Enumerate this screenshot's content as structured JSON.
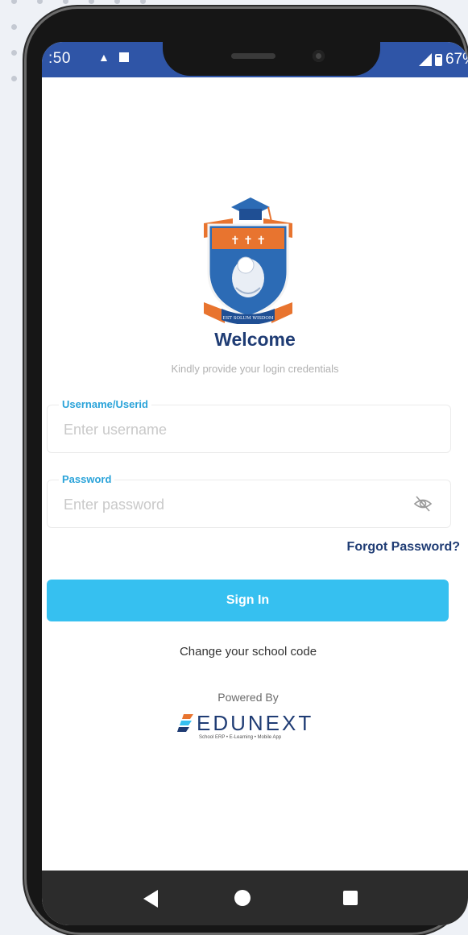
{
  "status_bar": {
    "time": ":50",
    "battery": "67%"
  },
  "logo": {
    "school_motto": "EST SOLUM WISDOM"
  },
  "login": {
    "welcome": "Welcome",
    "subtitle": "Kindly provide your login credentials",
    "username_label": "Username/Userid",
    "username_placeholder": "Enter username",
    "username_value": "",
    "password_label": "Password",
    "password_placeholder": "Enter password",
    "password_value": "",
    "forgot_password": "Forgot Password?",
    "sign_in": "Sign In",
    "change_school_code": "Change your school code"
  },
  "footer": {
    "powered_by": "Powered By",
    "brand_name": "EDUNEXT",
    "brand_tagline": "School ERP • E-Learning • Mobile App"
  },
  "icons": {
    "password_toggle": "eye-off-icon",
    "nav_back": "back-triangle-icon",
    "nav_home": "home-circle-icon",
    "nav_recent": "recent-apps-square-icon"
  },
  "colors": {
    "status_bar": "#2f55a7",
    "primary_button": "#36c0f0",
    "heading": "#1f3c74",
    "field_label": "#2aa3d9",
    "crest_orange": "#e8742f",
    "crest_blue": "#2c6bb5"
  }
}
